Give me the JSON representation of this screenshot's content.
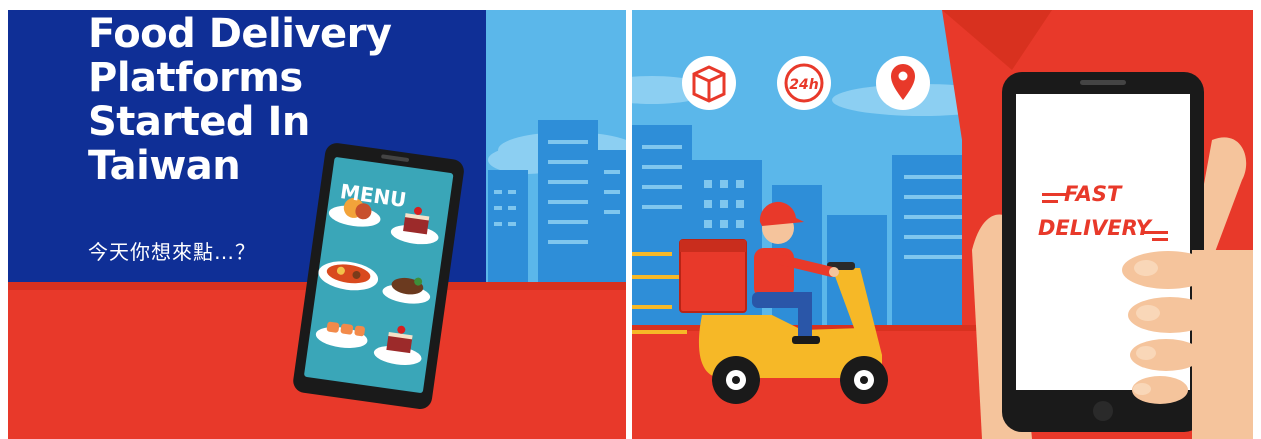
{
  "left_panel": {
    "title_lines": [
      "Food Delivery",
      "Platforms",
      "Started In",
      "Taiwan"
    ],
    "subtitle": "今天你想來點…？",
    "phone_screen_label": "MENU"
  },
  "right_panel": {
    "icons": [
      "box-icon",
      "24h-icon",
      "location-pin-icon"
    ],
    "icon_text_24h": "24h",
    "phone_text_line1": "FAST",
    "phone_text_line2": "DELIVERY"
  },
  "colors": {
    "navy": "#0f2f96",
    "sky": "#5bb7ea",
    "building": "#2e8ed8",
    "red": "#e8392a",
    "yellow": "#f6b827",
    "phone_body": "#1a1a1a",
    "menu_screen": "#3aa6b8",
    "skin": "#f5c49c"
  }
}
